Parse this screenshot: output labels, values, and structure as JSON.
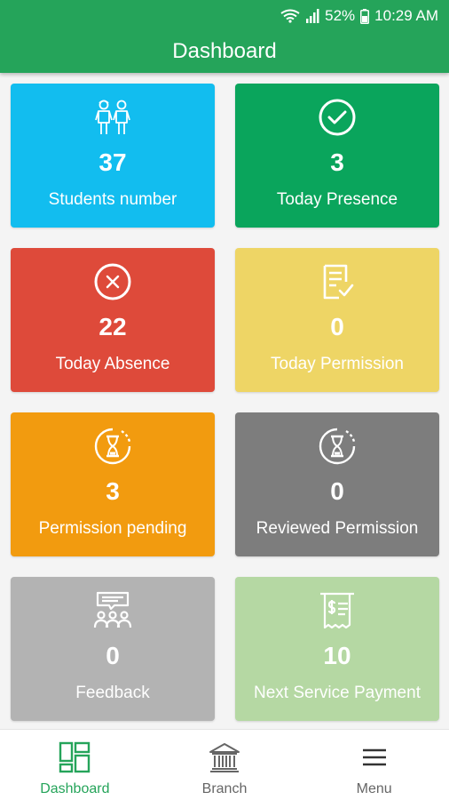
{
  "status": {
    "battery": "52%",
    "time": "10:29 AM"
  },
  "app": {
    "title": "Dashboard"
  },
  "colors": {
    "primary": "#25a45a",
    "cyan": "#12bdef",
    "green": "#0aa55c",
    "red": "#de4a3a",
    "yellow": "#eed565",
    "orange": "#f29b0f",
    "darkgray": "#7d7d7d",
    "lightgray": "#b3b3b3",
    "lightgreen": "#b5d8a3"
  },
  "cards": [
    {
      "value": "37",
      "label": "Students number",
      "icon": "students-icon",
      "color": "#12bdef"
    },
    {
      "value": "3",
      "label": "Today Presence",
      "icon": "check-circle-icon",
      "color": "#0aa55c"
    },
    {
      "value": "22",
      "label": "Today Absence",
      "icon": "x-circle-icon",
      "color": "#de4a3a"
    },
    {
      "value": "0",
      "label": "Today Permission",
      "icon": "document-check-icon",
      "color": "#eed565"
    },
    {
      "value": "3",
      "label": "Permission pending",
      "icon": "hourglass-icon",
      "color": "#f29b0f"
    },
    {
      "value": "0",
      "label": "Reviewed Permission",
      "icon": "hourglass-icon",
      "color": "#7d7d7d"
    },
    {
      "value": "0",
      "label": "Feedback",
      "icon": "feedback-icon",
      "color": "#b3b3b3"
    },
    {
      "value": "10",
      "label": "Next Service Payment",
      "icon": "receipt-icon",
      "color": "#b5d8a3"
    }
  ],
  "nav": [
    {
      "label": "Dashboard",
      "icon": "dashboard-icon",
      "active": true
    },
    {
      "label": "Branch",
      "icon": "bank-icon",
      "active": false
    },
    {
      "label": "Menu",
      "icon": "menu-icon",
      "active": false
    }
  ]
}
